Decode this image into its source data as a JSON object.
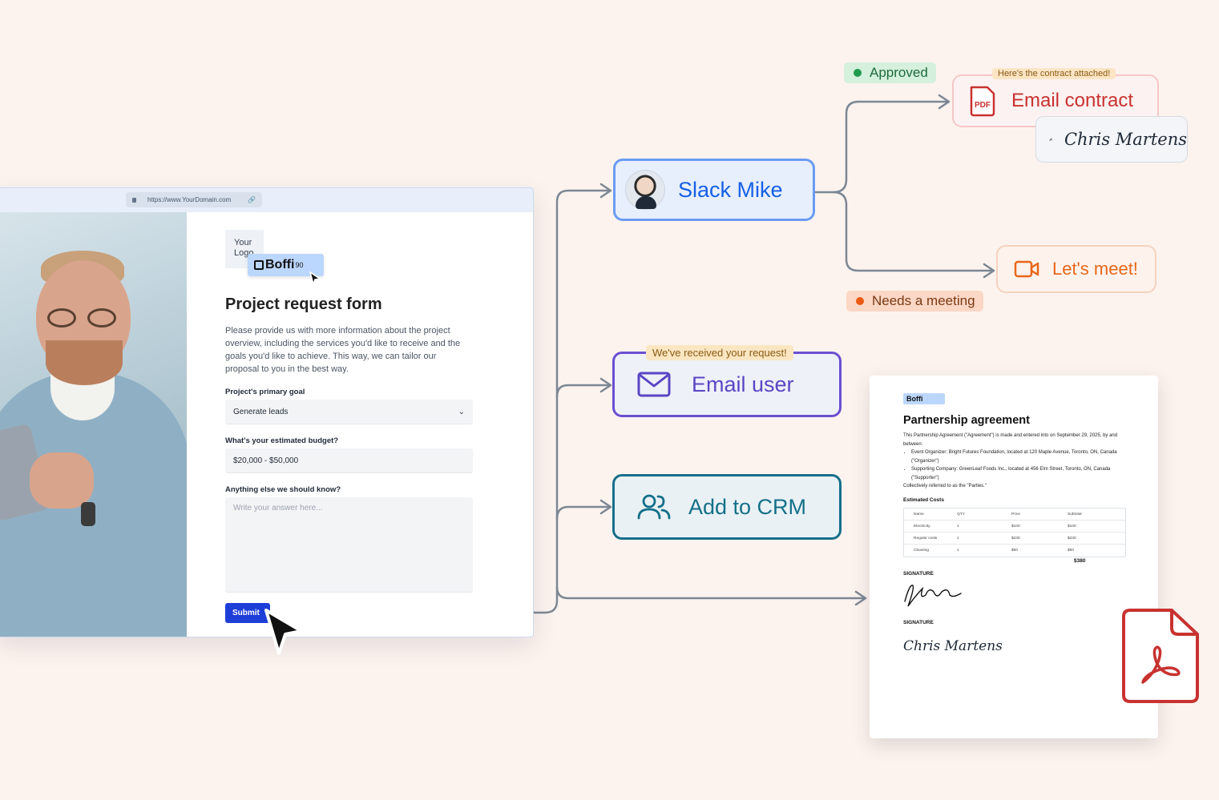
{
  "browser": {
    "url": "https://www.YourDomain.com"
  },
  "form": {
    "logo_placeholder": "Your Logo",
    "brand_name": "Boffi",
    "brand_suffix": "90",
    "title": "Project request form",
    "description": "Please provide us with more information about the project overview, including the services you'd like to receive and the goals you'd like to achieve. This way, we can tailor our proposal to you in the best way.",
    "goal_label": "Project's primary goal",
    "goal_value": "Generate leads",
    "budget_label": "What's your estimated budget?",
    "budget_value": "$20,000 - $50,000",
    "notes_label": "Anything else we should know?",
    "notes_placeholder": "Write your answer here...",
    "submit_label": "Submit"
  },
  "actions": {
    "slack": "Slack Mike",
    "email_user": "Email user",
    "email_user_tag": "We've received your request!",
    "crm": "Add to CRM",
    "email_contract": "Email contract",
    "email_contract_tag": "Here's the contract attached!",
    "contract_icon_text": "PDF",
    "meet": "Let's meet!",
    "approved": "Approved",
    "needs_meeting": "Needs a meeting",
    "signature_name": "Chris Martens"
  },
  "document": {
    "logo": "Boffi",
    "title": "Partnership agreement",
    "intro": "This Partnership Agreement (\"Agreement\") is made and entered into on September 29, 2025, by and between:",
    "party1": "Event Organizer: Bright Futures Foundation, located at 120 Maple Avenue, Toronto, ON, Canada (\"Organizer\")",
    "party2": "Supporting Company: GreenLeaf Foods Inc., located at 456 Elm Street, Toronto, ON, Canada (\"Supporter\")",
    "collective": "Collectively referred to as the \"Parties.\"",
    "costs_heading": "Estimated Costs",
    "table_headers": [
      "Name",
      "QTY",
      "Price",
      "Subtotal"
    ],
    "table_rows": [
      [
        "Electricity",
        "1",
        "$100",
        "$100"
      ],
      [
        "Regular costs",
        "1",
        "$230",
        "$230"
      ],
      [
        "Cleaning",
        "1",
        "$50",
        "$50"
      ]
    ],
    "total": "$380",
    "signature_label_1": "SIGNATURE",
    "signature_label_2": "SIGNATURE",
    "signature_2": "Chris Martens"
  },
  "colors": {
    "background": "#fcf3ee",
    "slack": "#1660e6",
    "email_user": "#5b45c4",
    "crm": "#137089",
    "contract": "#c8322f",
    "meet": "#e8671a",
    "approved": "#1e9b4f",
    "needs_meeting": "#ea5a12",
    "submit": "#1e3ed8"
  }
}
